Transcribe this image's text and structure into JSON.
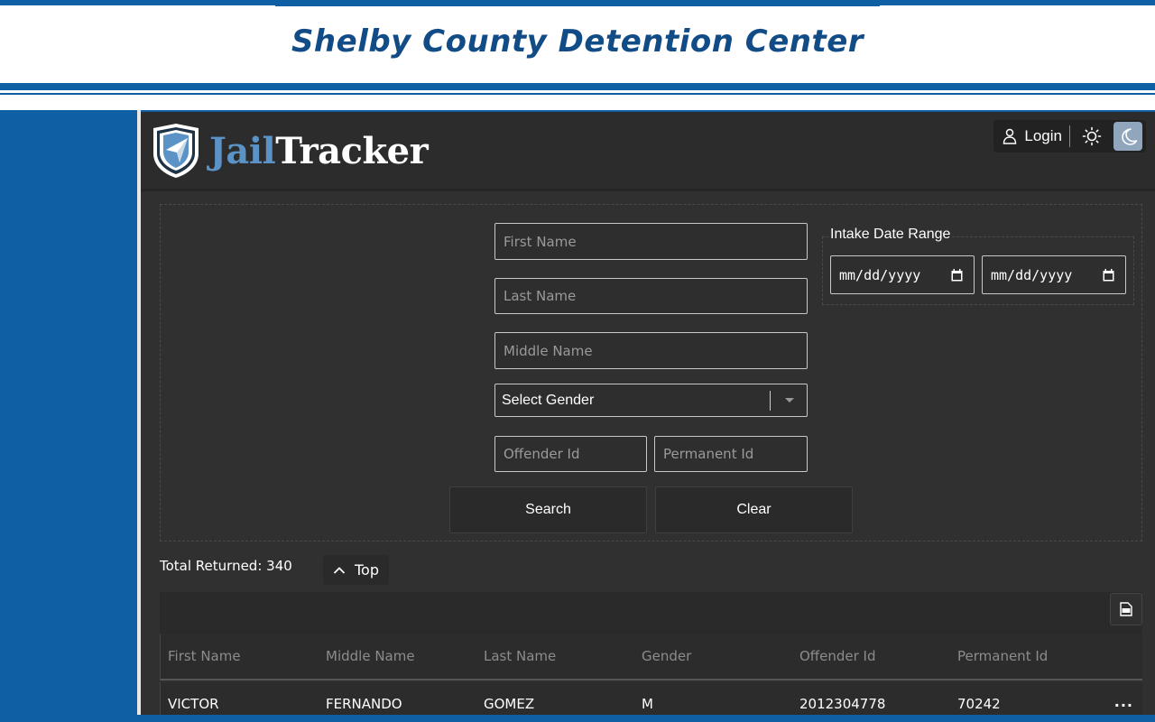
{
  "banner": {
    "title": "Shelby County Detention Center"
  },
  "header": {
    "logo_part1": "Jail",
    "logo_part2": "Tracker",
    "login_label": "Login"
  },
  "search": {
    "first_name_placeholder": "First Name",
    "last_name_placeholder": "Last Name",
    "middle_name_placeholder": "Middle Name",
    "gender_select_value": "Select Gender",
    "offender_id_placeholder": "Offender Id",
    "permanent_id_placeholder": "Permanent Id",
    "date_range_legend": "Intake Date Range",
    "date_from": "mm/dd/yyyy",
    "date_to": "mm/dd/yyyy",
    "search_label": "Search",
    "clear_label": "Clear"
  },
  "results": {
    "total_label": "Total Returned: 340",
    "top_label": "Top",
    "columns": [
      "First Name",
      "Middle Name",
      "Last Name",
      "Gender",
      "Offender Id",
      "Permanent Id"
    ],
    "rows": [
      {
        "first": "VICTOR",
        "middle": "FERNANDO",
        "last": "GOMEZ",
        "gender": "M",
        "offender_id": "2012304778",
        "permanent_id": "70242",
        "menu": "..."
      }
    ]
  },
  "colors": {
    "brand_blue": "#0e5fa3",
    "banner_title": "#124c86",
    "panel_bg": "#303030",
    "logo_accent": "#5b93c6"
  }
}
